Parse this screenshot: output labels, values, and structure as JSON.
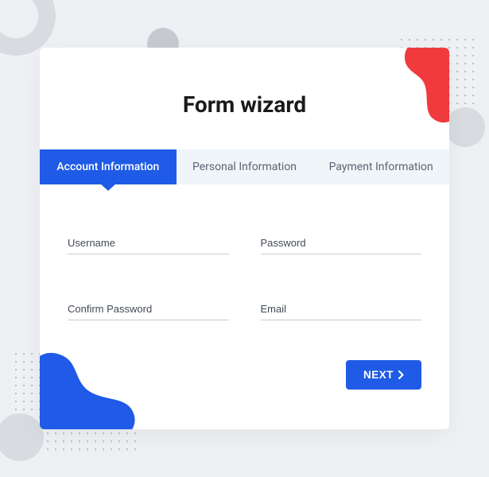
{
  "title": "Form wizard",
  "tabs": [
    {
      "label": "Account Information",
      "active": true
    },
    {
      "label": "Personal Information",
      "active": false
    },
    {
      "label": "Payment Information",
      "active": false
    }
  ],
  "fields": {
    "username": {
      "placeholder": "Username",
      "value": ""
    },
    "password": {
      "placeholder": "Password",
      "value": ""
    },
    "confirm_password": {
      "placeholder": "Confirm Password",
      "value": ""
    },
    "email": {
      "placeholder": "Email",
      "value": ""
    }
  },
  "buttons": {
    "next": "NEXT"
  },
  "colors": {
    "primary": "#1f5be6",
    "accent_red": "#f03a3e"
  }
}
